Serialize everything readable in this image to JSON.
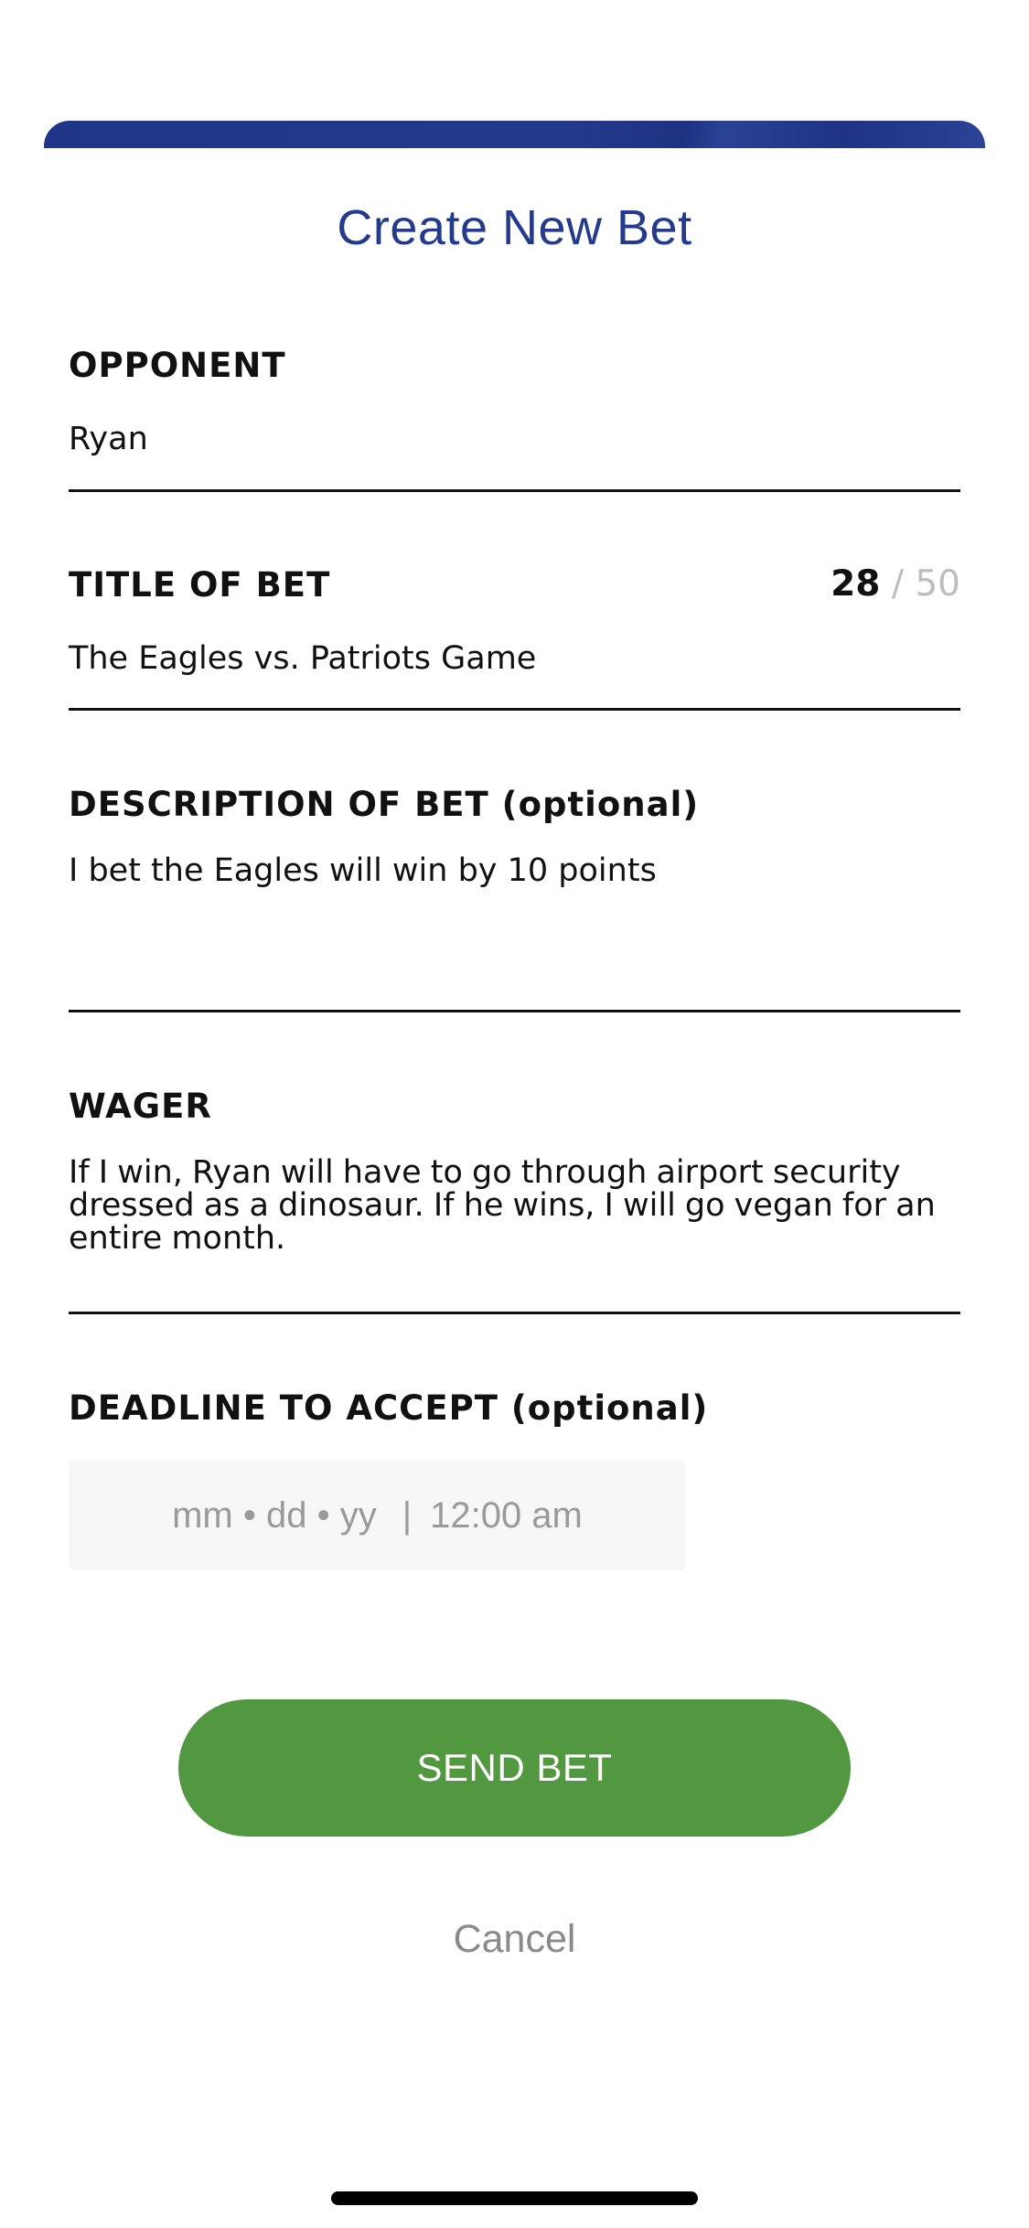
{
  "modal": {
    "title": "Create New Bet"
  },
  "form": {
    "opponent": {
      "label": "OPPONENT",
      "value": "Ryan"
    },
    "title_of_bet": {
      "label": "TITLE OF BET",
      "value": "The Eagles vs. Patriots Game",
      "char_count": "28",
      "char_limit": "/ 50"
    },
    "description": {
      "label": "DESCRIPTION OF BET (optional)",
      "value": "I bet the Eagles will win by 10 points"
    },
    "wager": {
      "label": "WAGER",
      "value": "If I win, Ryan will have to go through airport security dressed as a dinosaur. If he wins, I will go vegan for an entire month."
    },
    "deadline": {
      "label": "DEADLINE TO ACCEPT (optional)",
      "date_placeholder": "mm • dd • yy",
      "separator": "|",
      "time_placeholder": "12:00 am"
    }
  },
  "actions": {
    "send_label": "SEND BET",
    "cancel_label": "Cancel"
  },
  "colors": {
    "header_bar": "#243a8d",
    "title": "#243b8d",
    "send_button": "#529840",
    "cancel_text": "#8a8a8a",
    "date_field_bg": "#f7f7f7"
  }
}
